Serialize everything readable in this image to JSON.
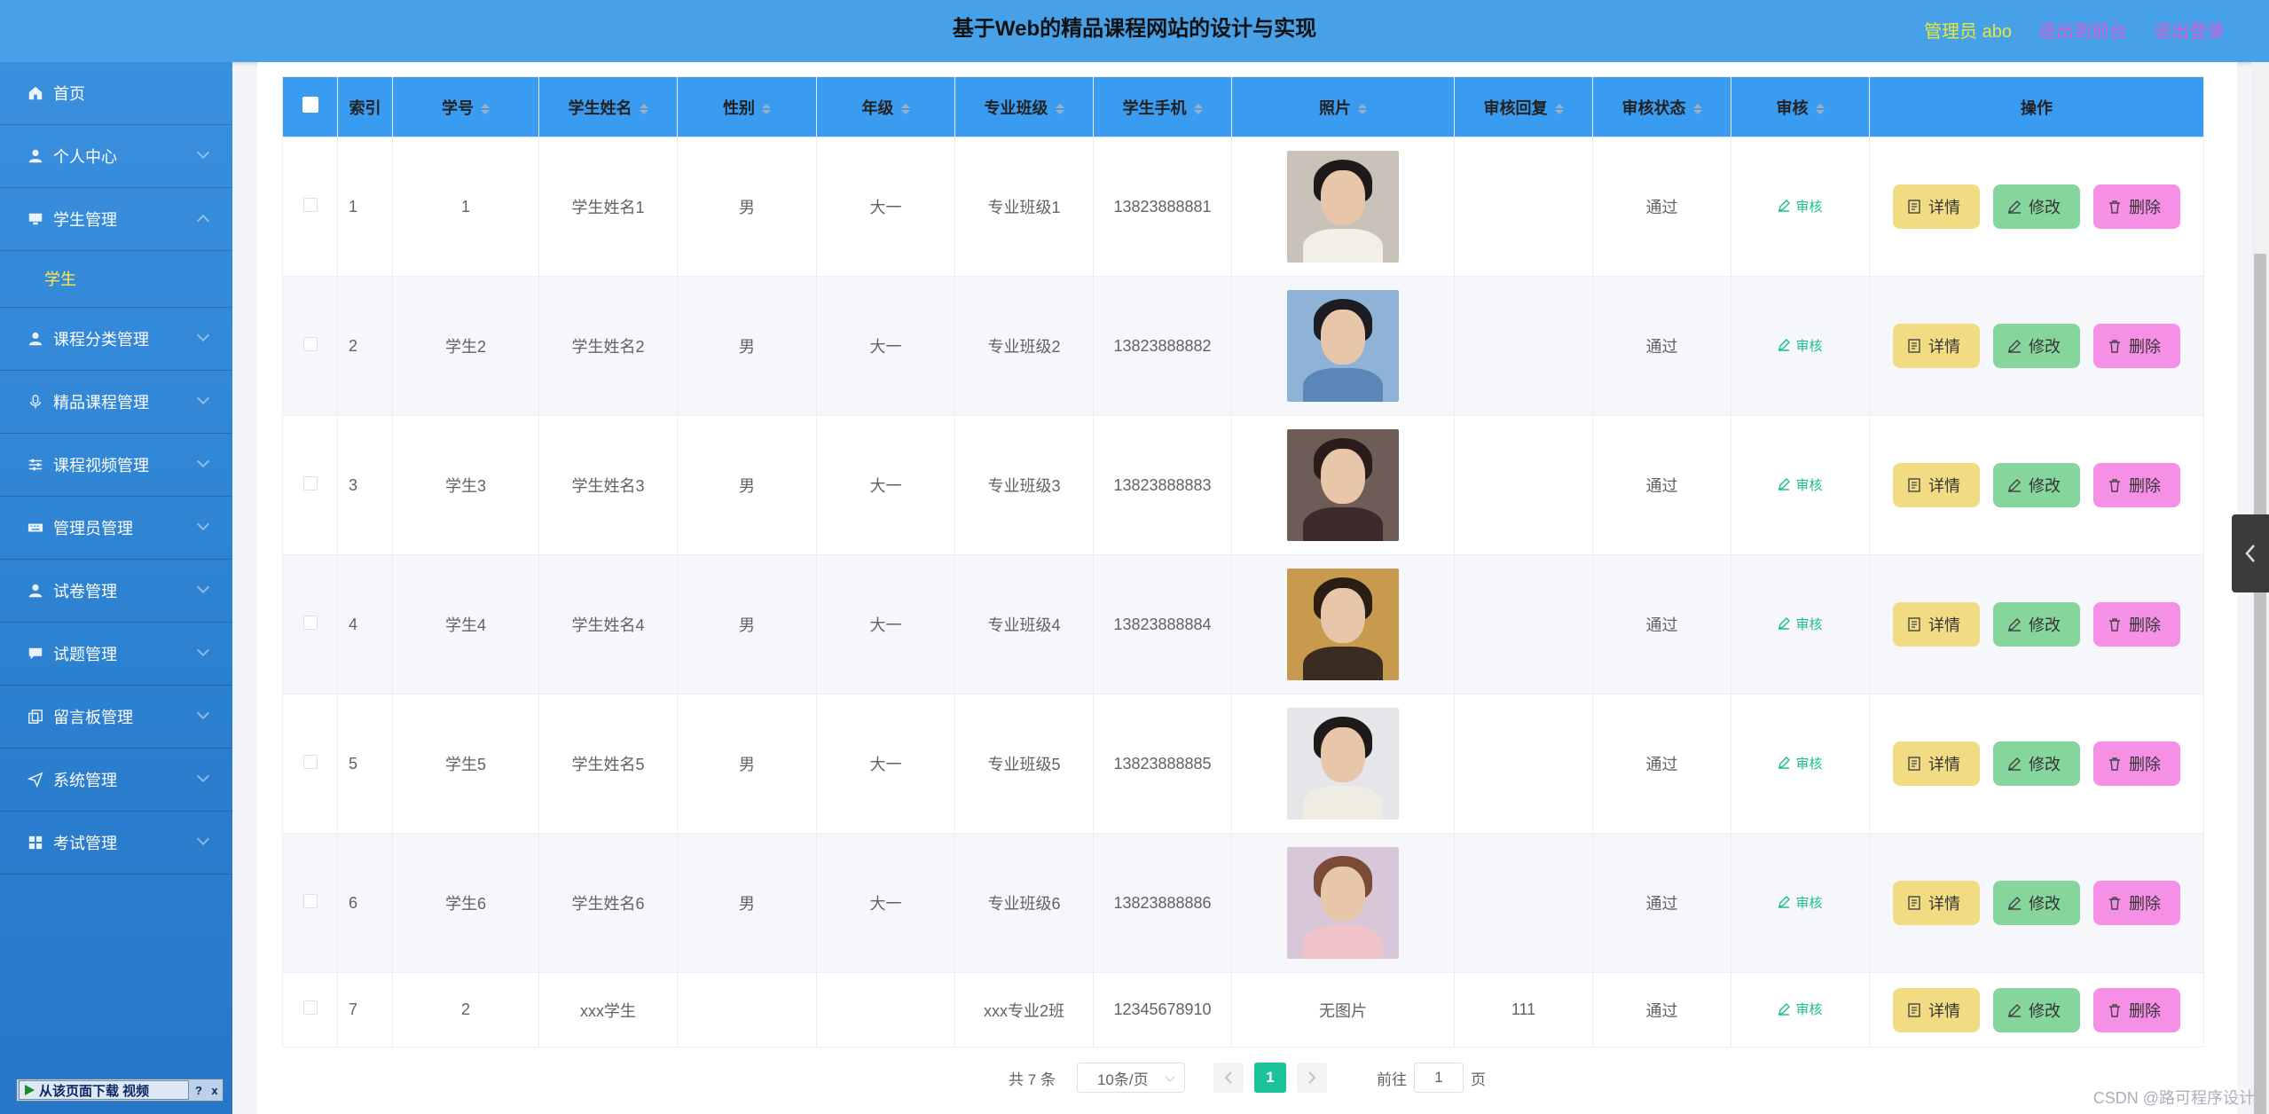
{
  "header": {
    "title": "基于Web的精品课程网站的设计与实现",
    "admin_label": "管理员 abo",
    "to_front_label": "退出到前台",
    "logout_label": "退出登录",
    "colors": {
      "header_bg": "#46a1e8",
      "admin_text": "#e8e83a",
      "link_text": "#d45bd6"
    }
  },
  "sidebar": {
    "items": [
      {
        "label": "首页",
        "icon": "home-icon"
      },
      {
        "label": "个人中心",
        "icon": "user-icon"
      },
      {
        "label": "学生管理",
        "icon": "monitor-icon",
        "expanded": true,
        "children": [
          {
            "label": "学生"
          }
        ]
      },
      {
        "label": "课程分类管理",
        "icon": "user-icon"
      },
      {
        "label": "精品课程管理",
        "icon": "mic-icon"
      },
      {
        "label": "课程视频管理",
        "icon": "sliders-icon"
      },
      {
        "label": "管理员管理",
        "icon": "keyboard-icon"
      },
      {
        "label": "试卷管理",
        "icon": "user-icon"
      },
      {
        "label": "试题管理",
        "icon": "chat-icon"
      },
      {
        "label": "留言板管理",
        "icon": "copy-icon"
      },
      {
        "label": "系统管理",
        "icon": "send-icon"
      },
      {
        "label": "考试管理",
        "icon": "grid-icon"
      }
    ],
    "download_bar": {
      "label": "从该页面下载 视频",
      "help": "?",
      "close": "x"
    }
  },
  "table": {
    "columns": [
      "索引",
      "学号",
      "学生姓名",
      "性别",
      "年级",
      "专业班级",
      "学生手机",
      "照片",
      "审核回复",
      "审核状态",
      "审核",
      "操作"
    ],
    "audit_label": "审核",
    "buttons": {
      "detail": "详情",
      "edit": "修改",
      "delete": "删除"
    },
    "rows": [
      {
        "index": "1",
        "student_no": "1",
        "name": "学生姓名1",
        "gender": "男",
        "grade": "大一",
        "class": "专业班级1",
        "phone": "13823888881",
        "photo": "photo",
        "reply": "",
        "status": "通过"
      },
      {
        "index": "2",
        "student_no": "学生2",
        "name": "学生姓名2",
        "gender": "男",
        "grade": "大一",
        "class": "专业班级2",
        "phone": "13823888882",
        "photo": "photo",
        "reply": "",
        "status": "通过"
      },
      {
        "index": "3",
        "student_no": "学生3",
        "name": "学生姓名3",
        "gender": "男",
        "grade": "大一",
        "class": "专业班级3",
        "phone": "13823888883",
        "photo": "photo",
        "reply": "",
        "status": "通过"
      },
      {
        "index": "4",
        "student_no": "学生4",
        "name": "学生姓名4",
        "gender": "男",
        "grade": "大一",
        "class": "专业班级4",
        "phone": "13823888884",
        "photo": "photo",
        "reply": "",
        "status": "通过"
      },
      {
        "index": "5",
        "student_no": "学生5",
        "name": "学生姓名5",
        "gender": "男",
        "grade": "大一",
        "class": "专业班级5",
        "phone": "13823888885",
        "photo": "photo",
        "reply": "",
        "status": "通过"
      },
      {
        "index": "6",
        "student_no": "学生6",
        "name": "学生姓名6",
        "gender": "男",
        "grade": "大一",
        "class": "专业班级6",
        "phone": "13823888886",
        "photo": "photo",
        "reply": "",
        "status": "通过"
      },
      {
        "index": "7",
        "student_no": "2",
        "name": "xxx学生",
        "gender": "",
        "grade": "",
        "class": "xxx专业2班",
        "phone": "12345678910",
        "photo": "none",
        "photo_text": "无图片",
        "reply": "111",
        "status": "通过"
      }
    ]
  },
  "pagination": {
    "total": "共 7 条",
    "page_size": "10条/页",
    "current_page": "1",
    "jump_prefix": "前往",
    "jump_value": "1",
    "jump_suffix": "页"
  },
  "watermark": "CSDN @路可程序设计"
}
